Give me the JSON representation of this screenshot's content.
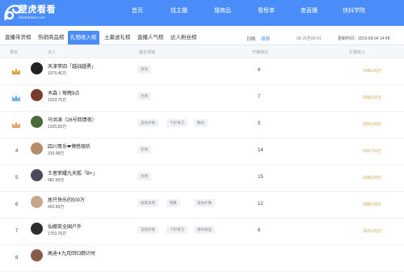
{
  "brand": {
    "name": "壁虎看看",
    "sub": "bihukankan.com"
  },
  "nav": [
    "首页",
    "找主播",
    "搜商品",
    "看榜单",
    "查直播",
    "快抖学院"
  ],
  "tabs": [
    "直播带货榜",
    "热销商品榜",
    "礼物收入榜",
    "土豪送礼榜",
    "直播人气榜",
    "达人粉丝榜"
  ],
  "dimension": {
    "label": "日榜",
    "value": "周榜",
    "date_range": "08-26至09-01",
    "updated": "更新时间：2019-09-04 14:48"
  },
  "columns": [
    "排名",
    "达人",
    "擅长领域",
    "开播场次",
    "礼物收入"
  ],
  "rows": [
    {
      "rank": "1",
      "name": "天津李四「越战越勇」",
      "fans": "1079.46万",
      "tags": [
        "亮场"
      ],
      "sessions": "6",
      "gift": "7445.66万"
    },
    {
      "rank": "2",
      "name": "木森丨每晚9点",
      "fans": "1203.75万",
      "tags": [
        "亮场"
      ],
      "sessions": "7",
      "gift": "2990.51万"
    },
    {
      "rank": "3",
      "name": "马洪涛（26号回馈夜）",
      "fans": "1325.83万",
      "tags": [
        "美妆护肤",
        "个护清洁",
        "数码"
      ],
      "sessions": "5",
      "gift": "2855.60万"
    },
    {
      "rank": "4",
      "name": "四川哥乐❤博感夜听",
      "fans": "310.98万",
      "tags": [
        "亮场"
      ],
      "sessions": "14",
      "gift": "2027.51万"
    },
    {
      "rank": "5",
      "name": "王者荣耀九天狐「B+」",
      "fans": "981.60万",
      "tags": [
        "亮场"
      ],
      "sessions": "15",
      "gift": "1939.39万"
    },
    {
      "rank": "6",
      "name": "居只快乐的500万",
      "fans": "402.60万",
      "tags": [
        "居家日用",
        "鞋靴",
        "美妆护肤"
      ],
      "sessions": "12",
      "gift": "1868.39万"
    },
    {
      "rank": "7",
      "name": "仙娜英全国户外",
      "fans": "1753.76万",
      "tags": [
        "美妆护肤",
        "个护清洁",
        "休闲食品"
      ],
      "sessions": "6",
      "gift": "1676.65万"
    },
    {
      "rank": "8",
      "name": "高迪✈九月回归倒计时",
      "fans": "",
      "tags": [],
      "sessions": "",
      "gift": ""
    }
  ]
}
